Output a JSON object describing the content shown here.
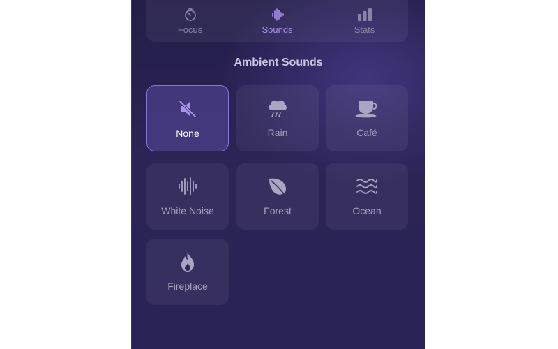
{
  "tabs": {
    "focus": {
      "label": "Focus",
      "icon": "timer-icon"
    },
    "sounds": {
      "label": "Sounds",
      "icon": "waveform-icon",
      "active": true
    },
    "stats": {
      "label": "Stats",
      "icon": "bar-chart-icon"
    }
  },
  "section": {
    "title": "Ambient Sounds"
  },
  "sounds": [
    {
      "label": "None",
      "icon": "speaker-muted-icon",
      "selected": true
    },
    {
      "label": "Rain",
      "icon": "cloud-rain-icon"
    },
    {
      "label": "Café",
      "icon": "coffee-cup-icon"
    },
    {
      "label": "White Noise",
      "icon": "waveform-icon"
    },
    {
      "label": "Forest",
      "icon": "leaf-icon"
    },
    {
      "label": "Ocean",
      "icon": "waves-icon"
    },
    {
      "label": "Fireplace",
      "icon": "flame-icon"
    }
  ],
  "colors": {
    "accent": "#a890f0",
    "panel_bg": "#2a2356",
    "tile_selected_border": "#8b74d8"
  }
}
